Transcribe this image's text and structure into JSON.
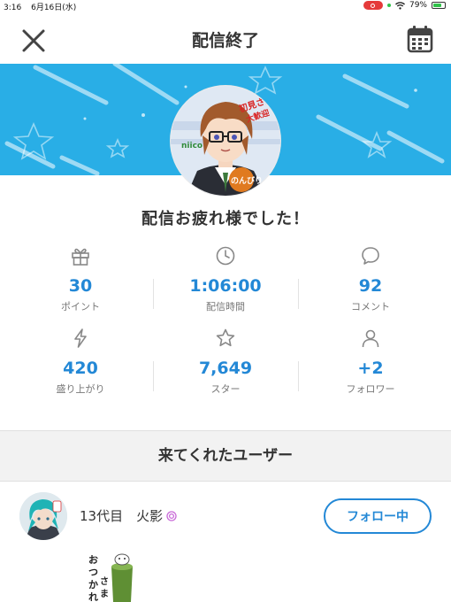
{
  "status_bar": {
    "time": "3:16",
    "date": "6月16日(水)",
    "battery": "79%",
    "battery_level": 0.79
  },
  "header": {
    "title": "配信終了",
    "close_icon": "close-icon",
    "calendar_icon": "calendar-icon"
  },
  "banner": {
    "background_color": "#29aee6",
    "avatar_badge_top": "初見さん大歓迎",
    "avatar_badge_bottom": "のんびり",
    "avatar_logo": "niico"
  },
  "message": "配信お疲れ様でした！",
  "stats": [
    {
      "icon": "gift-icon",
      "value": "30",
      "label": "ポイント"
    },
    {
      "icon": "clock-icon",
      "value": "1:06:00",
      "label": "配信時間"
    },
    {
      "icon": "comment-icon",
      "value": "92",
      "label": "コメント"
    },
    {
      "icon": "lightning-icon",
      "value": "420",
      "label": "盛り上がり"
    },
    {
      "icon": "star-icon",
      "value": "7,649",
      "label": "スター"
    },
    {
      "icon": "person-icon",
      "value": "+2",
      "label": "フォロワー"
    }
  ],
  "visitors": {
    "title": "来てくれたユーザー",
    "users": [
      {
        "name": "13代目　火影",
        "follow_label": "フォロー中"
      }
    ],
    "sticker_text": "おつかれさま"
  },
  "colors": {
    "accent": "#2388d6",
    "banner": "#29aee6",
    "section_bg": "#f2f2f2"
  }
}
